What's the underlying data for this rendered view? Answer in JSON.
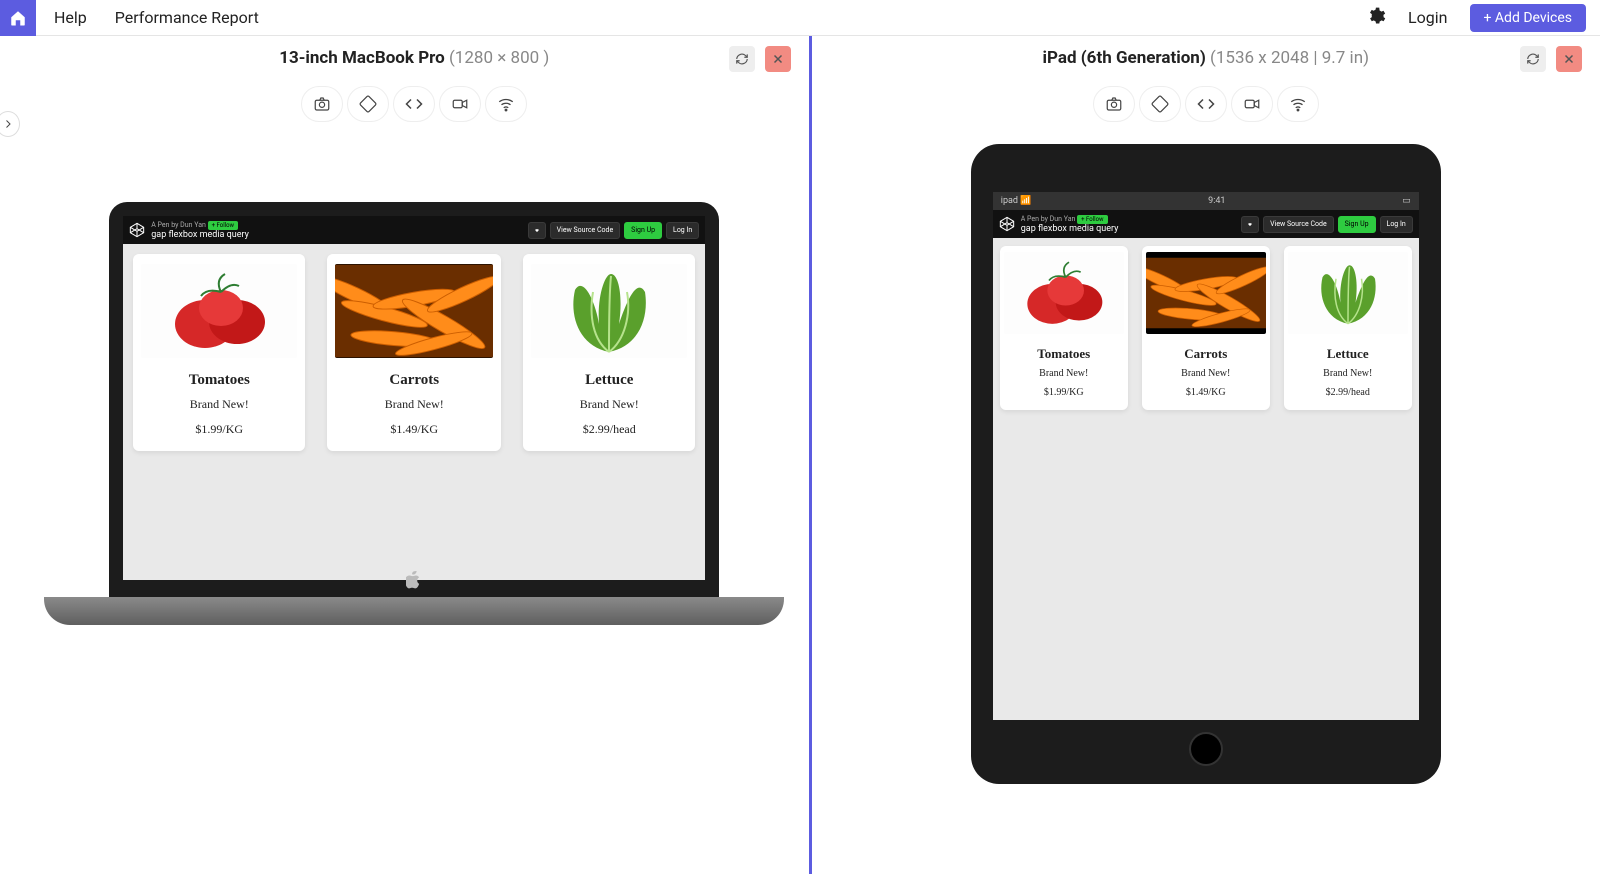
{
  "nav": {
    "help": "Help",
    "perf": "Performance Report",
    "login": "Login",
    "add": "+ Add Devices"
  },
  "panes": {
    "mac": {
      "name": "13-inch MacBook Pro ",
      "dims": "(1280 × 800 )"
    },
    "ipad": {
      "name": "iPad (6th Generation) ",
      "dims": "(1536 x 2048 | 9.7 in)"
    }
  },
  "status": {
    "carrier": "ipad",
    "time": "9:41"
  },
  "codepen": {
    "author": "A Pen by Dun Yan",
    "follow": "+ Follow",
    "title": "gap flexbox media query",
    "view": "View Source Code",
    "signup": "Sign Up",
    "login": "Log In"
  },
  "cards": [
    {
      "name": "Tomatoes",
      "badge": "Brand New!",
      "price": "$1.99/KG"
    },
    {
      "name": "Carrots",
      "badge": "Brand New!",
      "price": "$1.49/KG"
    },
    {
      "name": "Lettuce",
      "badge": "Brand New!",
      "price": "$2.99/head"
    }
  ]
}
